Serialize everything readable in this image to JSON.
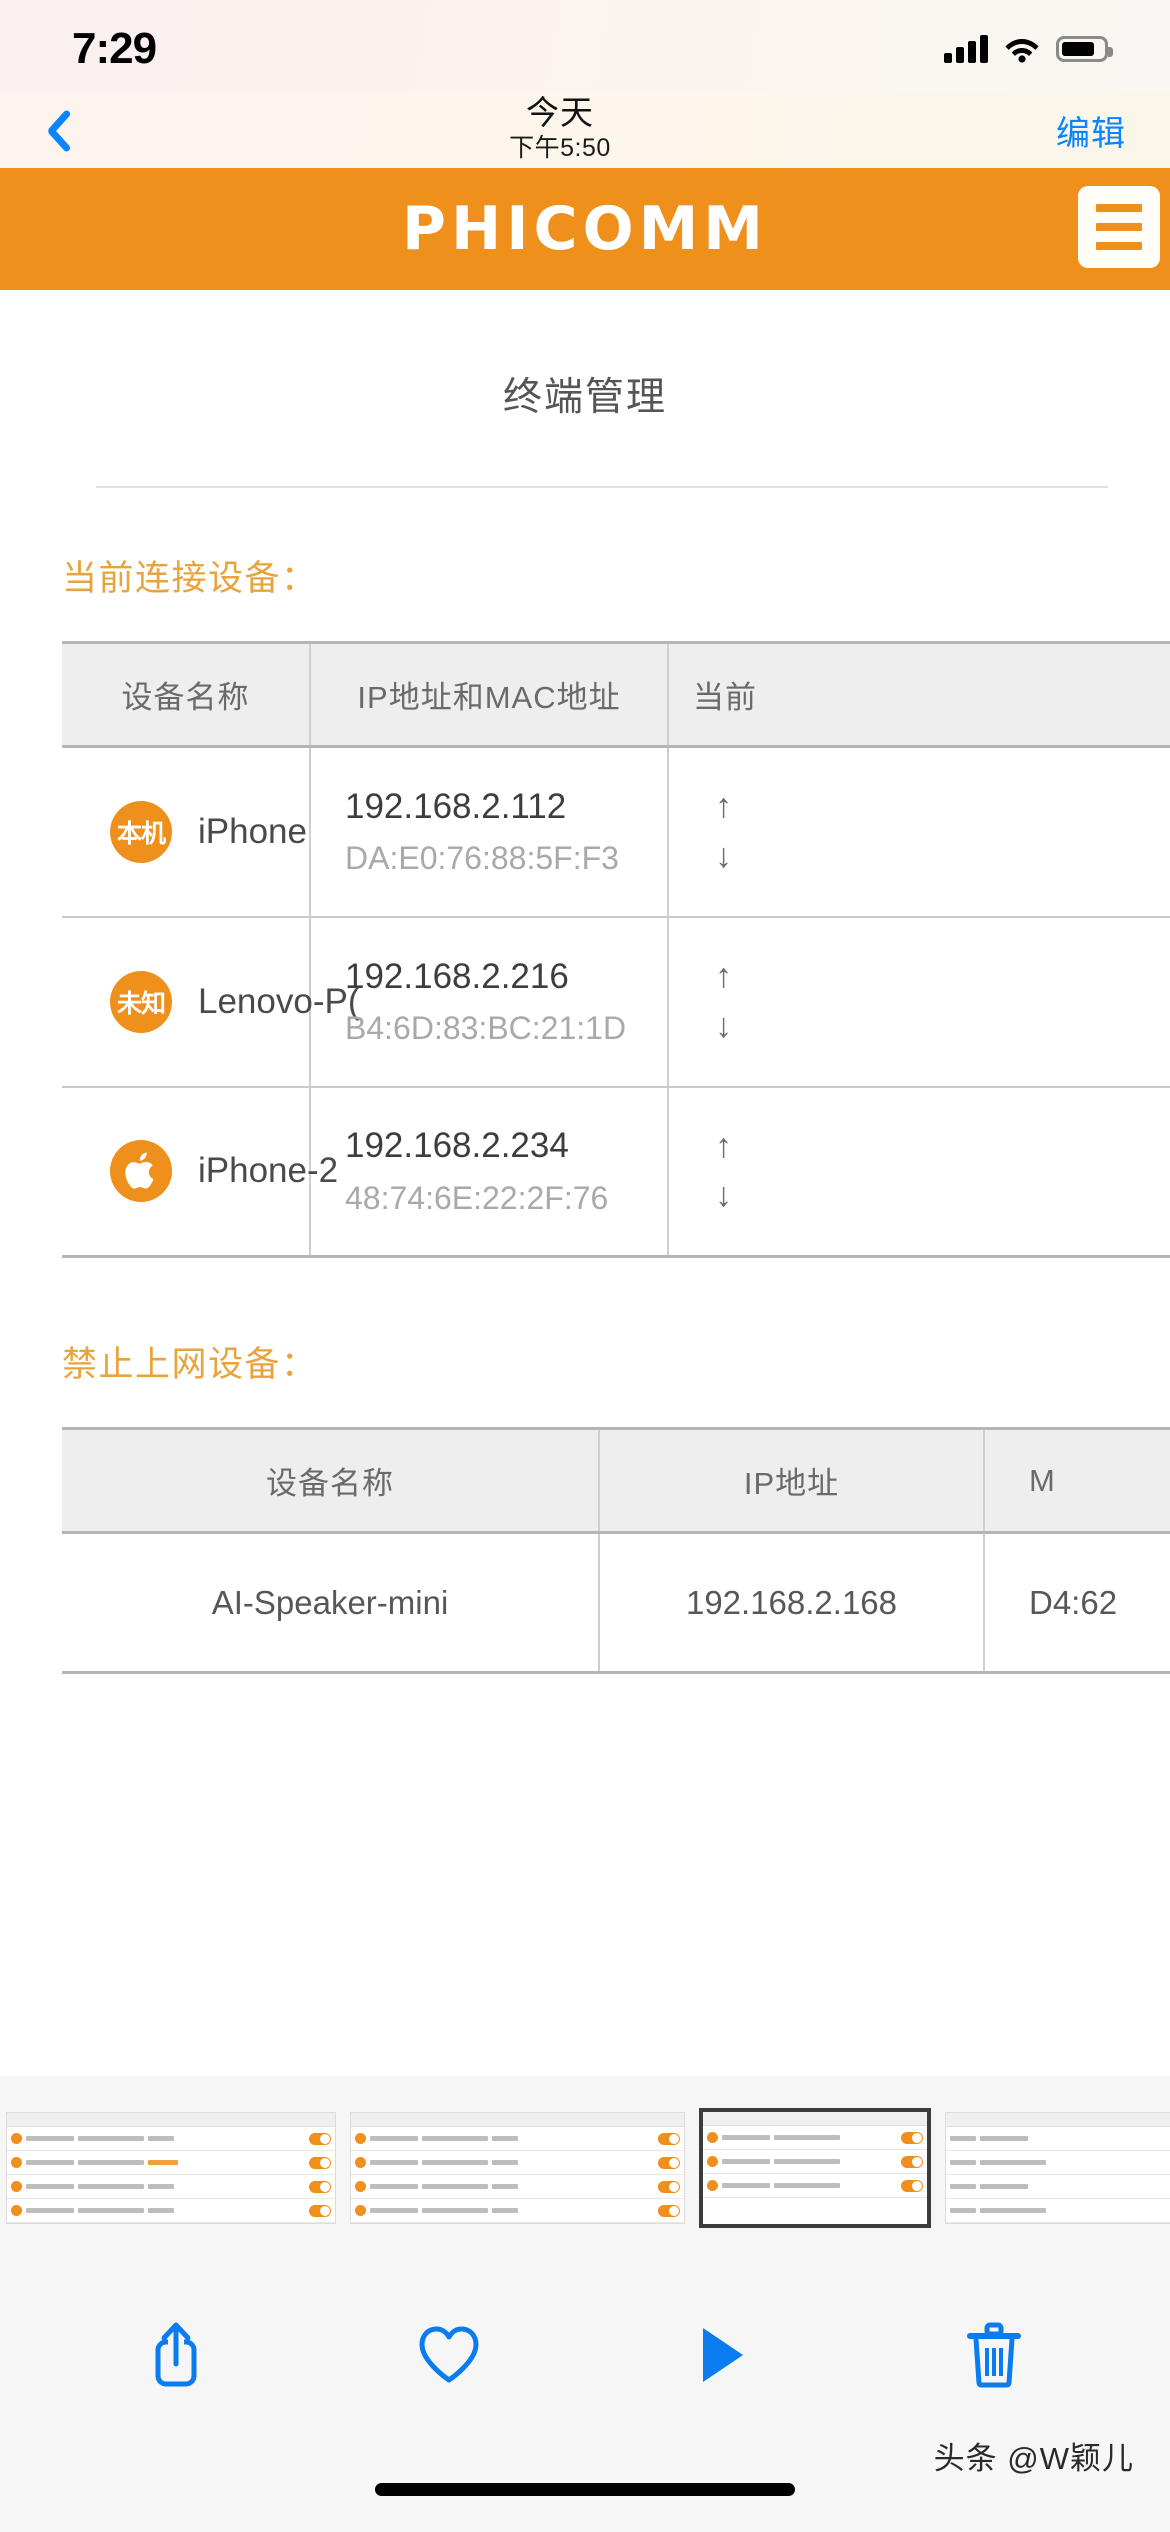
{
  "status_bar": {
    "time": "7:29",
    "icons": [
      "cellular-signal-icon",
      "wifi-icon",
      "battery-icon"
    ]
  },
  "nav_bar": {
    "back_icon": "chevron-left-icon",
    "title": "今天",
    "subtitle": "下午5:50",
    "edit_label": "编辑"
  },
  "photo": {
    "brand": {
      "logo_text": "PHICOMM",
      "menu_icon": "hamburger-menu-icon",
      "bar_color": "#ef8f1c"
    },
    "page_title": "终端管理",
    "connected": {
      "section_label": "当前连接设备：",
      "headers": [
        "设备名称",
        "IP地址和MAC地址",
        "当前"
      ],
      "rows": [
        {
          "badge": "本机",
          "badge_type": "text",
          "name": "iPhone",
          "ip": "192.168.2.112",
          "mac": "DA:E0:76:88:5F:F3",
          "up_arrow": "↑",
          "down_arrow": "↓"
        },
        {
          "badge": "未知",
          "badge_type": "text",
          "name": "Lenovo-P(",
          "ip": "192.168.2.216",
          "mac": "B4:6D:83:BC:21:1D",
          "up_arrow": "↑",
          "down_arrow": "↓"
        },
        {
          "badge": "apple-logo-icon",
          "badge_type": "icon",
          "name": "iPhone-2",
          "ip": "192.168.2.234",
          "mac": "48:74:6E:22:2F:76",
          "up_arrow": "↑",
          "down_arrow": "↓"
        }
      ]
    },
    "blocked": {
      "section_label": "禁止上网设备：",
      "headers": [
        "设备名称",
        "IP地址",
        "M"
      ],
      "rows": [
        {
          "name": "AI-Speaker-mini",
          "ip": "192.168.2.168",
          "mac": "D4:62"
        }
      ]
    }
  },
  "toolbar": {
    "share_label": "share-icon",
    "favorite_label": "heart-icon",
    "slideshow_label": "play-icon",
    "delete_label": "trash-icon"
  },
  "watermark": "头条 @W颖儿",
  "colors": {
    "brand_orange": "#ef8f1c",
    "section_label": "#e8a43c",
    "ios_blue": "#0a84ff"
  }
}
